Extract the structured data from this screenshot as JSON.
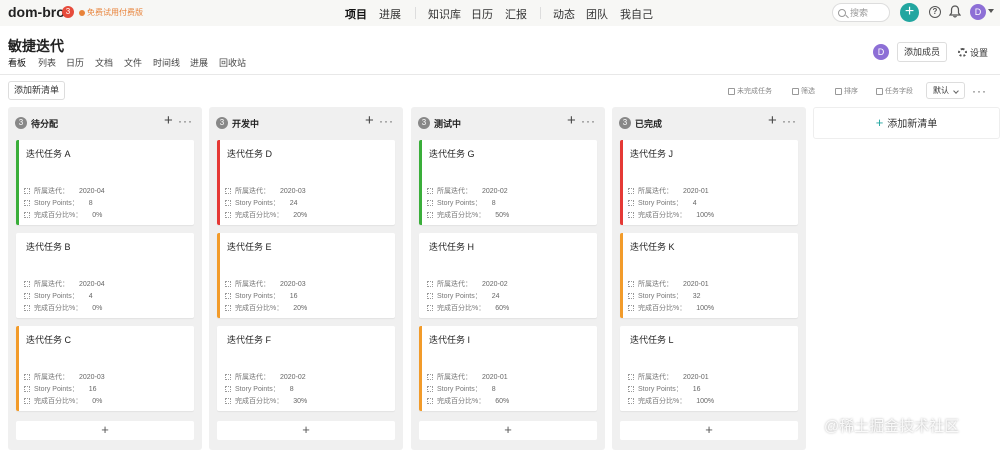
{
  "app": {
    "logo": "dom-bro",
    "badge_count": "3",
    "trial_text": "免费试用付费版"
  },
  "nav": {
    "items": [
      "项目",
      "进展",
      "知识库",
      "日历",
      "汇报",
      "动态",
      "团队",
      "我自己"
    ],
    "active_index": 0
  },
  "search": {
    "placeholder": "搜索"
  },
  "user": {
    "avatar_letter": "D"
  },
  "project": {
    "title": "敏捷迭代",
    "tabs": [
      "看板",
      "列表",
      "日历",
      "文档",
      "文件",
      "时间线",
      "进展",
      "回收站"
    ],
    "active_tab": 0,
    "add_member": "添加成员",
    "settings": "设置"
  },
  "toolbar": {
    "add_list": "添加新清单",
    "incomplete": "未完成任务",
    "filter": "筛选",
    "sort": "排序",
    "fields": "任务字段",
    "sort_value": "默认"
  },
  "meta_labels": {
    "iteration": "所属迭代：",
    "points": "Story Points：",
    "percent": "完成百分比%："
  },
  "columns": [
    {
      "title": "待分配",
      "count": "3",
      "cards": [
        {
          "name": "迭代任务 A",
          "color": "#3aae3a",
          "iteration": "2020-04",
          "points": "8",
          "percent": "0%"
        },
        {
          "name": "迭代任务 B",
          "color": "",
          "iteration": "2020-04",
          "points": "4",
          "percent": "0%"
        },
        {
          "name": "迭代任务 C",
          "color": "#f29b2a",
          "iteration": "2020-03",
          "points": "16",
          "percent": "0%"
        }
      ]
    },
    {
      "title": "开发中",
      "count": "3",
      "cards": [
        {
          "name": "迭代任务 D",
          "color": "#e53935",
          "iteration": "2020-03",
          "points": "24",
          "percent": "20%"
        },
        {
          "name": "迭代任务 E",
          "color": "#f29b2a",
          "iteration": "2020-03",
          "points": "16",
          "percent": "20%"
        },
        {
          "name": "迭代任务 F",
          "color": "",
          "iteration": "2020-02",
          "points": "8",
          "percent": "30%"
        }
      ]
    },
    {
      "title": "测试中",
      "count": "3",
      "cards": [
        {
          "name": "迭代任务 G",
          "color": "#3aae3a",
          "iteration": "2020-02",
          "points": "8",
          "percent": "50%"
        },
        {
          "name": "迭代任务 H",
          "color": "",
          "iteration": "2020-02",
          "points": "24",
          "percent": "60%"
        },
        {
          "name": "迭代任务 I",
          "color": "#f29b2a",
          "iteration": "2020-01",
          "points": "8",
          "percent": "60%"
        }
      ]
    },
    {
      "title": "已完成",
      "count": "3",
      "cards": [
        {
          "name": "迭代任务 J",
          "color": "#e53935",
          "iteration": "2020-01",
          "points": "4",
          "percent": "100%"
        },
        {
          "name": "迭代任务 K",
          "color": "#f29b2a",
          "iteration": "2020-01",
          "points": "32",
          "percent": "100%"
        },
        {
          "name": "迭代任务 L",
          "color": "",
          "iteration": "2020-01",
          "points": "16",
          "percent": "100%"
        }
      ]
    }
  ],
  "new_list": "添加新清单",
  "watermark": "@稀土掘金技术社区"
}
